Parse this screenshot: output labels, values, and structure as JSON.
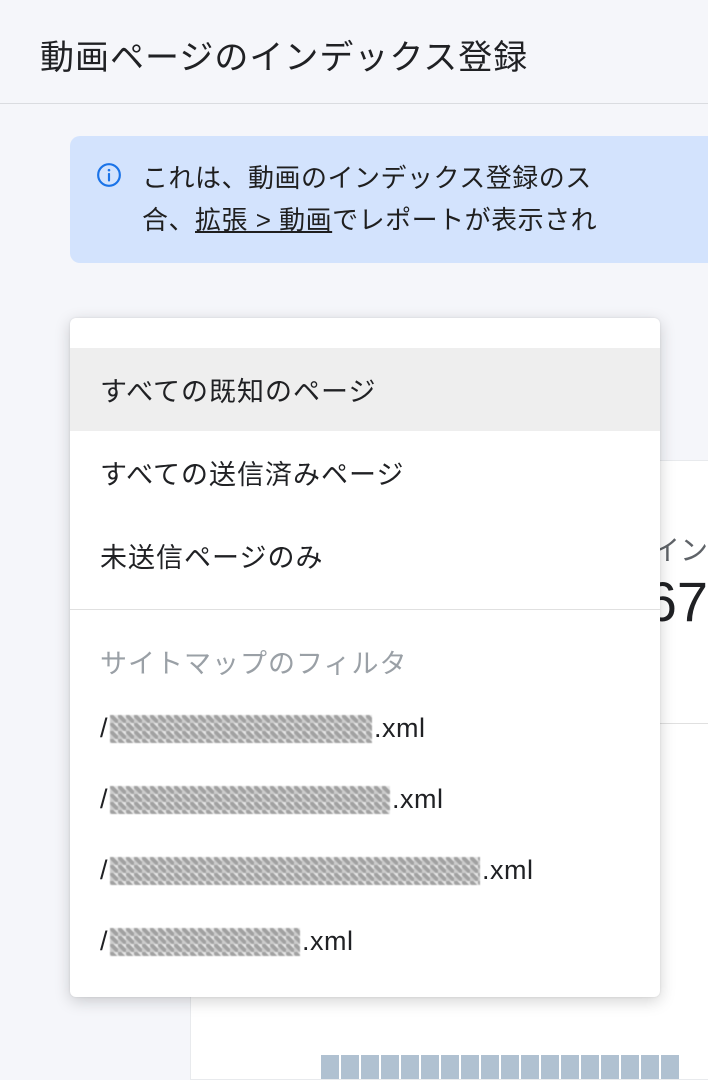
{
  "page_title": "動画ページのインデックス登録",
  "info_banner": {
    "line1_prefix": "これは、動画のインデックス登録のス",
    "line2_prefix": "合、",
    "link_text": "拡張 > 動画",
    "line2_suffix": "でレポートが表示され"
  },
  "dropdown": {
    "items": [
      {
        "label": "すべての既知のページ",
        "selected": true
      },
      {
        "label": "すべての送信済みページ",
        "selected": false
      },
      {
        "label": "未送信ページのみ",
        "selected": false
      }
    ],
    "section_header": "サイトマップのフィルタ",
    "sitemaps": [
      {
        "prefix": "/",
        "redacted_width": 262,
        "suffix": ".xml"
      },
      {
        "prefix": "/",
        "redacted_width": 280,
        "suffix": ".xml"
      },
      {
        "prefix": "/",
        "redacted_width": 370,
        "suffix": ".xml"
      },
      {
        "prefix": "/",
        "redacted_width": 190,
        "suffix": ".xml"
      }
    ]
  },
  "backdrop": {
    "label_fragment": "イン",
    "number_fragment": ",67"
  }
}
